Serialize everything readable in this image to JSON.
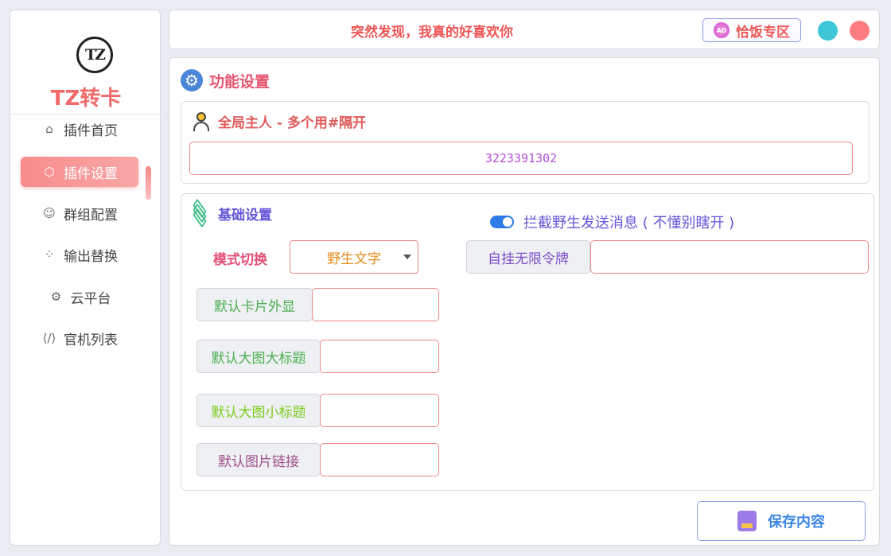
{
  "sidebar": {
    "logo_text": "TZ",
    "app_name": "TZ转卡",
    "items": [
      {
        "label": "插件首页",
        "icon": "home-icon"
      },
      {
        "label": "插件设置",
        "icon": "settings-hex-icon",
        "active": true
      },
      {
        "label": "群组配置",
        "icon": "user-gear-icon"
      },
      {
        "label": "输出替换",
        "icon": "grid-icon"
      },
      {
        "label": "云平台",
        "icon": "gear-icon"
      },
      {
        "label": "官机列表",
        "icon": "code-icon"
      }
    ]
  },
  "topbar": {
    "marquee": "突然发现，我真的好喜欢你",
    "promo_label": "恰饭专区",
    "promo_icon_text": "AD"
  },
  "main": {
    "section_title": "功能设置",
    "owner": {
      "title": "全局主人 - 多个用#隔开",
      "value": "3223391302"
    },
    "basic": {
      "title": "基础设置",
      "toggle_label": "拦截野生发送消息 ( 不懂别瞎开 )",
      "toggle_on": true,
      "mode_label": "模式切换",
      "mode_value": "野生文字",
      "token_label": "自挂无限令牌",
      "token_value": "",
      "fields": [
        {
          "label": "默认卡片外显",
          "value": ""
        },
        {
          "label": "默认大图大标题",
          "value": ""
        },
        {
          "label": "默认大图小标题",
          "value": ""
        },
        {
          "label": "默认图片链接",
          "value": ""
        }
      ]
    },
    "save_label": "保存内容"
  },
  "colors": {
    "accent_red": "#f16a6a",
    "purple": "#6356d9",
    "blue": "#3c86e6",
    "field_green": "#4caf50",
    "field_lime": "#7ccc1a",
    "field_plum": "#a0508a"
  }
}
